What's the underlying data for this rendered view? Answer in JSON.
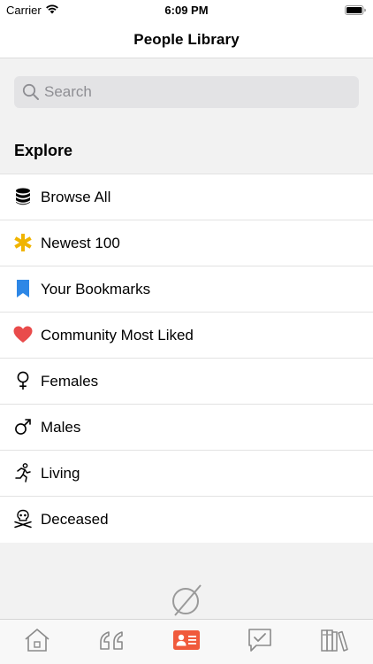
{
  "status_bar": {
    "carrier": "Carrier",
    "time": "6:09 PM"
  },
  "nav": {
    "title": "People Library"
  },
  "search": {
    "placeholder": "Search",
    "value": ""
  },
  "explore": {
    "header": "Explore",
    "items": [
      {
        "label": "Browse All",
        "icon": "database-icon"
      },
      {
        "label": "Newest 100",
        "icon": "asterisk-icon"
      },
      {
        "label": "Your Bookmarks",
        "icon": "bookmark-icon"
      },
      {
        "label": "Community Most Liked",
        "icon": "heart-icon"
      },
      {
        "label": "Females",
        "icon": "female-icon"
      },
      {
        "label": "Males",
        "icon": "male-icon"
      },
      {
        "label": "Living",
        "icon": "running-person-icon"
      },
      {
        "label": "Deceased",
        "icon": "skull-crossbones-icon"
      }
    ]
  },
  "tab_bar": {
    "tabs": [
      {
        "icon": "home-icon",
        "selected": false
      },
      {
        "icon": "quote-icon",
        "selected": false
      },
      {
        "icon": "id-card-icon",
        "selected": true
      },
      {
        "icon": "chat-check-icon",
        "selected": false
      },
      {
        "icon": "books-icon",
        "selected": false
      }
    ]
  },
  "colors": {
    "accent": "#f05a3c",
    "asterisk": "#f0b400",
    "bookmark": "#2d87e6",
    "heart": "#e94b4b",
    "tab_inactive": "#8a8a8a"
  }
}
